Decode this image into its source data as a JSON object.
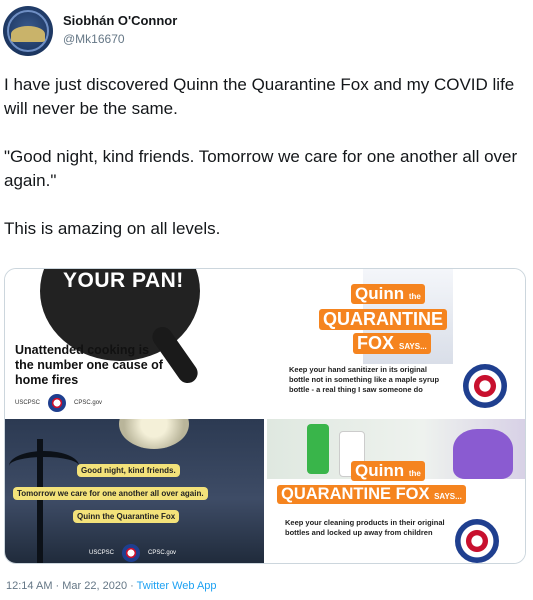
{
  "user": {
    "name": "Siobhán O'Connor",
    "handle": "@Mk16670"
  },
  "tweet": {
    "paragraphs": [
      "I have just discovered Quinn the Quarantine Fox and my COVID life will never be the same.",
      "\"Good night, kind friends. Tomorrow we care for one another all over again.\"",
      "This is amazing on all levels."
    ]
  },
  "media": {
    "tile1": {
      "headline": "YOUR PAN!",
      "warning": "Unattended cooking is the number one cause of home fires",
      "logo_left": "USCPSC",
      "logo_right": "CPSC.gov"
    },
    "tile2": {
      "line1": "Quinn",
      "line1_small": "the",
      "line2": "QUARANTINE",
      "line3": "FOX",
      "says": "SAYS...",
      "tip": "Keep your hand sanitizer in its original bottle not in something like a maple syrup bottle - a real thing I saw someone do"
    },
    "tile3": {
      "line1": "Good night, kind friends.",
      "line2": "Tomorrow we care for one another all over again.",
      "line3": "Quinn the Quarantine Fox",
      "logo_left": "USCPSC",
      "logo_right": "CPSC.gov"
    },
    "tile4": {
      "line1": "Quinn",
      "line1_small": "the",
      "line2": "QUARANTINE FOX",
      "says": "SAYS...",
      "tip": "Keep your cleaning products in their original bottles and locked up away from children"
    }
  },
  "meta": {
    "time": "12:14 AM · Mar 22, 2020 ·",
    "app": "Twitter Web App"
  },
  "colors": {
    "accent": "#1da1f2",
    "orange": "#f5841f",
    "text": "#14171a",
    "muted": "#657786"
  }
}
